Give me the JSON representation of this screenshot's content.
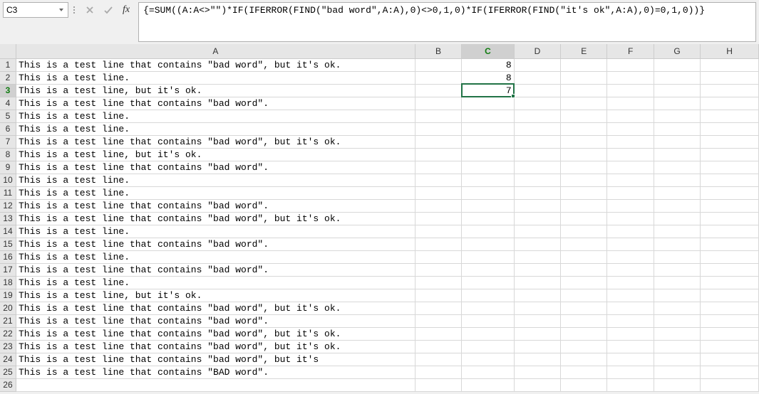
{
  "nameBox": {
    "value": "C3"
  },
  "formulaBar": {
    "fxLabel": "fx",
    "formula": "{=SUM((A:A<>\"\")*IF(IFERROR(FIND(\"bad word\",A:A),0)<>0,1,0)*IF(IFERROR(FIND(\"it's ok\",A:A),0)=0,1,0))}"
  },
  "columns": [
    "A",
    "B",
    "C",
    "D",
    "E",
    "F",
    "G",
    "H"
  ],
  "activeColumn": "C",
  "activeRow": 3,
  "activeCell": "C3",
  "rows": [
    {
      "n": 1,
      "a": "This is a test line that contains \"bad word\", but it's ok.",
      "c": "8"
    },
    {
      "n": 2,
      "a": "This is a test line.",
      "c": "8"
    },
    {
      "n": 3,
      "a": "This is a test line, but it's ok.",
      "c": "7"
    },
    {
      "n": 4,
      "a": "This is a test line that contains \"bad word\".",
      "c": ""
    },
    {
      "n": 5,
      "a": "This is a test line.",
      "c": ""
    },
    {
      "n": 6,
      "a": "This is a test line.",
      "c": ""
    },
    {
      "n": 7,
      "a": "This is a test line that contains \"bad word\", but it's ok.",
      "c": ""
    },
    {
      "n": 8,
      "a": "This is a test line, but it's ok.",
      "c": ""
    },
    {
      "n": 9,
      "a": "This is a test line that contains \"bad word\".",
      "c": ""
    },
    {
      "n": 10,
      "a": "This is a test line.",
      "c": ""
    },
    {
      "n": 11,
      "a": "This is a test line.",
      "c": ""
    },
    {
      "n": 12,
      "a": "This is a test line that contains \"bad word\".",
      "c": ""
    },
    {
      "n": 13,
      "a": "This is a test line that contains \"bad word\", but it's ok.",
      "c": ""
    },
    {
      "n": 14,
      "a": "This is a test line.",
      "c": ""
    },
    {
      "n": 15,
      "a": "This is a test line that contains \"bad word\".",
      "c": ""
    },
    {
      "n": 16,
      "a": "This is a test line.",
      "c": ""
    },
    {
      "n": 17,
      "a": "This is a test line that contains \"bad word\".",
      "c": ""
    },
    {
      "n": 18,
      "a": "This is a test line.",
      "c": ""
    },
    {
      "n": 19,
      "a": "This is a test line, but it's ok.",
      "c": ""
    },
    {
      "n": 20,
      "a": "This is a test line that contains \"bad word\", but it's ok.",
      "c": ""
    },
    {
      "n": 21,
      "a": "This is a test line that contains \"bad word\".",
      "c": ""
    },
    {
      "n": 22,
      "a": "This is a test line that contains \"bad word\", but it's ok.",
      "c": ""
    },
    {
      "n": 23,
      "a": "This is a test line that contains \"bad word\", but it's ok.",
      "c": ""
    },
    {
      "n": 24,
      "a": "This is a test line that contains \"bad word\", but it's",
      "c": ""
    },
    {
      "n": 25,
      "a": "This is a test line that contains \"BAD word\".",
      "c": ""
    },
    {
      "n": 26,
      "a": "",
      "c": ""
    }
  ]
}
